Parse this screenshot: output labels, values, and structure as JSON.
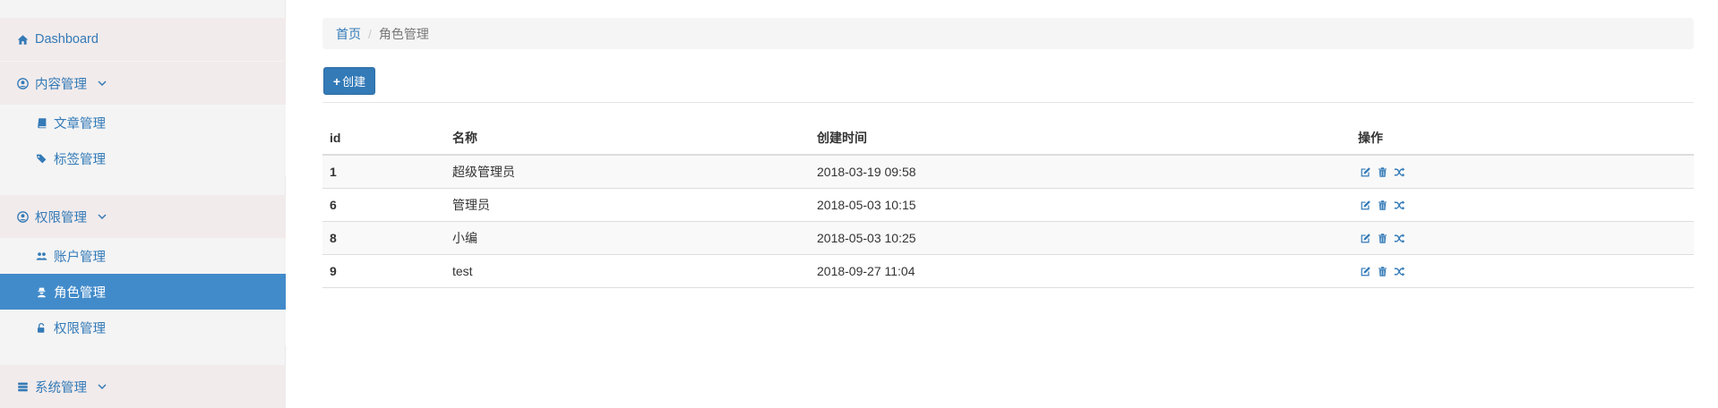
{
  "colors": {
    "link": "#337ab7",
    "active_bg": "#428bca",
    "primary_button": "#337ab7",
    "group_bg": "#f2ebeb",
    "sidebar_bg": "#f4f4f4"
  },
  "sidebar": {
    "items": [
      {
        "label": "Dashboard",
        "icon": "home-icon",
        "level": "top",
        "expandable": false,
        "active": false
      },
      {
        "label": "内容管理",
        "icon": "user-circle-icon",
        "level": "top",
        "expandable": true,
        "active": false
      },
      {
        "label": "文章管理",
        "icon": "book-icon",
        "level": "sub",
        "expandable": false,
        "active": false
      },
      {
        "label": "标签管理",
        "icon": "tags-icon",
        "level": "sub",
        "expandable": false,
        "active": false
      },
      {
        "label": "权限管理",
        "icon": "user-circle-icon",
        "level": "top",
        "expandable": true,
        "active": false
      },
      {
        "label": "账户管理",
        "icon": "users-icon",
        "level": "sub",
        "expandable": false,
        "active": false
      },
      {
        "label": "角色管理",
        "icon": "user-secret-icon",
        "level": "sub",
        "expandable": false,
        "active": true
      },
      {
        "label": "权限管理",
        "icon": "unlock-icon",
        "level": "sub",
        "expandable": false,
        "active": false
      },
      {
        "label": "系统管理",
        "icon": "server-icon",
        "level": "top",
        "expandable": true,
        "active": false
      }
    ]
  },
  "breadcrumb": {
    "home": "首页",
    "separator": "/",
    "current": "角色管理"
  },
  "toolbar": {
    "create_icon": "plus-icon",
    "create_label": "创建"
  },
  "table": {
    "columns": [
      "id",
      "名称",
      "创建时间",
      "操作"
    ],
    "rows": [
      {
        "id": "1",
        "name": "超级管理员",
        "created": "2018-03-19 09:58"
      },
      {
        "id": "6",
        "name": "管理员",
        "created": "2018-05-03 10:15"
      },
      {
        "id": "8",
        "name": "小编",
        "created": "2018-05-03 10:25"
      },
      {
        "id": "9",
        "name": "test",
        "created": "2018-09-27 11:04"
      }
    ],
    "actions": [
      "edit-icon",
      "trash-icon",
      "random-icon"
    ]
  }
}
